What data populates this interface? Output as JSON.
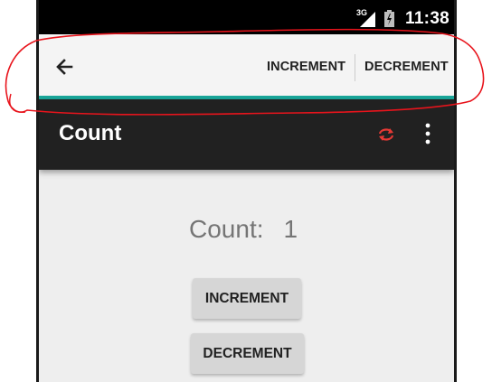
{
  "status_bar": {
    "network": "3G",
    "time": "11:38",
    "signal_icon": "signal-icon",
    "battery_icon": "battery-icon"
  },
  "action_mode": {
    "back_icon": "arrow-back-icon",
    "increment_label": "INCREMENT",
    "decrement_label": "DECREMENT",
    "accent_color": "#1aa79a"
  },
  "toolbar": {
    "title": "Count",
    "refresh_icon": "refresh-icon",
    "refresh_color": "#e53935",
    "overflow_icon": "more-vert-icon"
  },
  "content": {
    "count_label": "Count:",
    "count_value": "1",
    "increment_button": "INCREMENT",
    "decrement_button": "DECREMENT"
  },
  "annotation_color": "#e8141c"
}
